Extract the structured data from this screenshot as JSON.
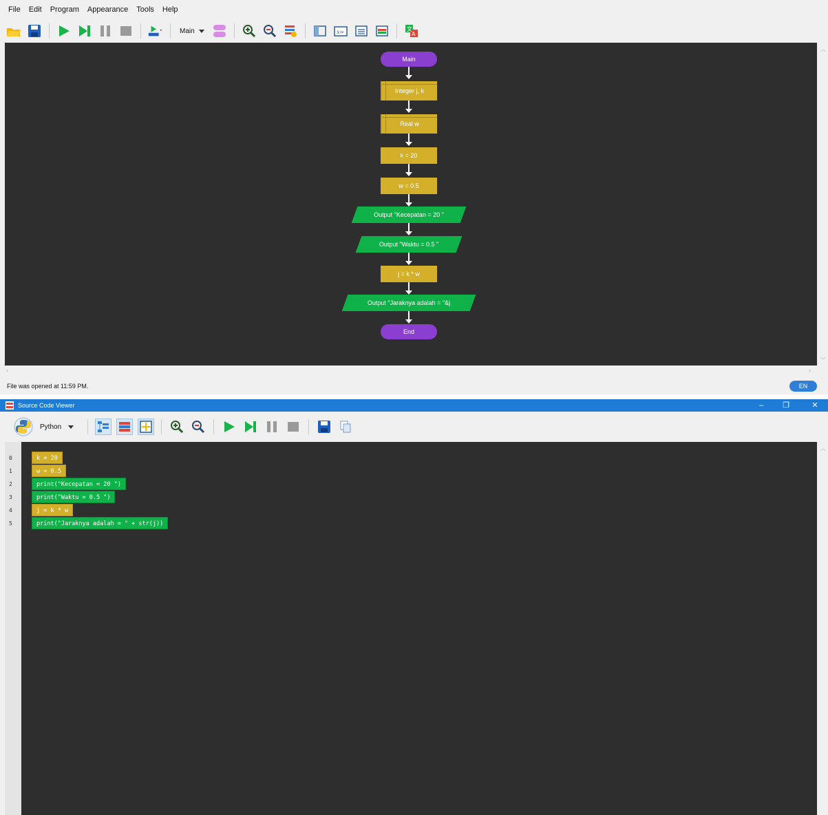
{
  "menubar": {
    "items": [
      "File",
      "Edit",
      "Program",
      "Appearance",
      "Tools",
      "Help"
    ]
  },
  "toolbar": {
    "function_selector": "Main",
    "icons": [
      "open-folder-icon",
      "save-icon",
      "run-icon",
      "step-icon",
      "pause-icon",
      "stop-icon",
      "speed-icon",
      "function-dropdown",
      "manage-functions-icon",
      "zoom-in-icon",
      "zoom-out-icon",
      "layout-icon",
      "layout-window-icon",
      "variable-watch-icon",
      "console-icon",
      "source-code-icon",
      "translate-icon"
    ]
  },
  "flowchart": {
    "start_label": "Main",
    "declare_1": "Integer j, k",
    "declare_2": "Real w",
    "assign_1": "k = 20",
    "assign_2": "w = 0.5",
    "output_1": "Output \"Kecepatan = 20 \"",
    "output_2": "Output \"Waktu = 0.5 \"",
    "assign_3": "j = k * w",
    "output_3": "Output \"Jaraknya adalah = \"&j",
    "end_label": "End",
    "colors": {
      "terminal": "#8b3fd1",
      "process": "#d4b02a",
      "output": "#0fb248",
      "canvas": "#2e2e2e"
    }
  },
  "status": {
    "message": "File was opened at 11:59 PM.",
    "language_badge": "EN"
  },
  "source_viewer": {
    "title": "Source Code Viewer",
    "language": "Python",
    "line_numbers": [
      "0",
      "1",
      "2",
      "3",
      "4",
      "5"
    ],
    "lines": [
      "k = 20",
      "w = 0.5",
      "print(\"Kecepatan = 20 \")",
      "print(\"Waktu = 0.5 \")",
      "j = k * w",
      "print(\"Jaraknya adalah = \" + str(j))"
    ],
    "window_controls": [
      "–",
      "❐",
      "✕"
    ]
  }
}
